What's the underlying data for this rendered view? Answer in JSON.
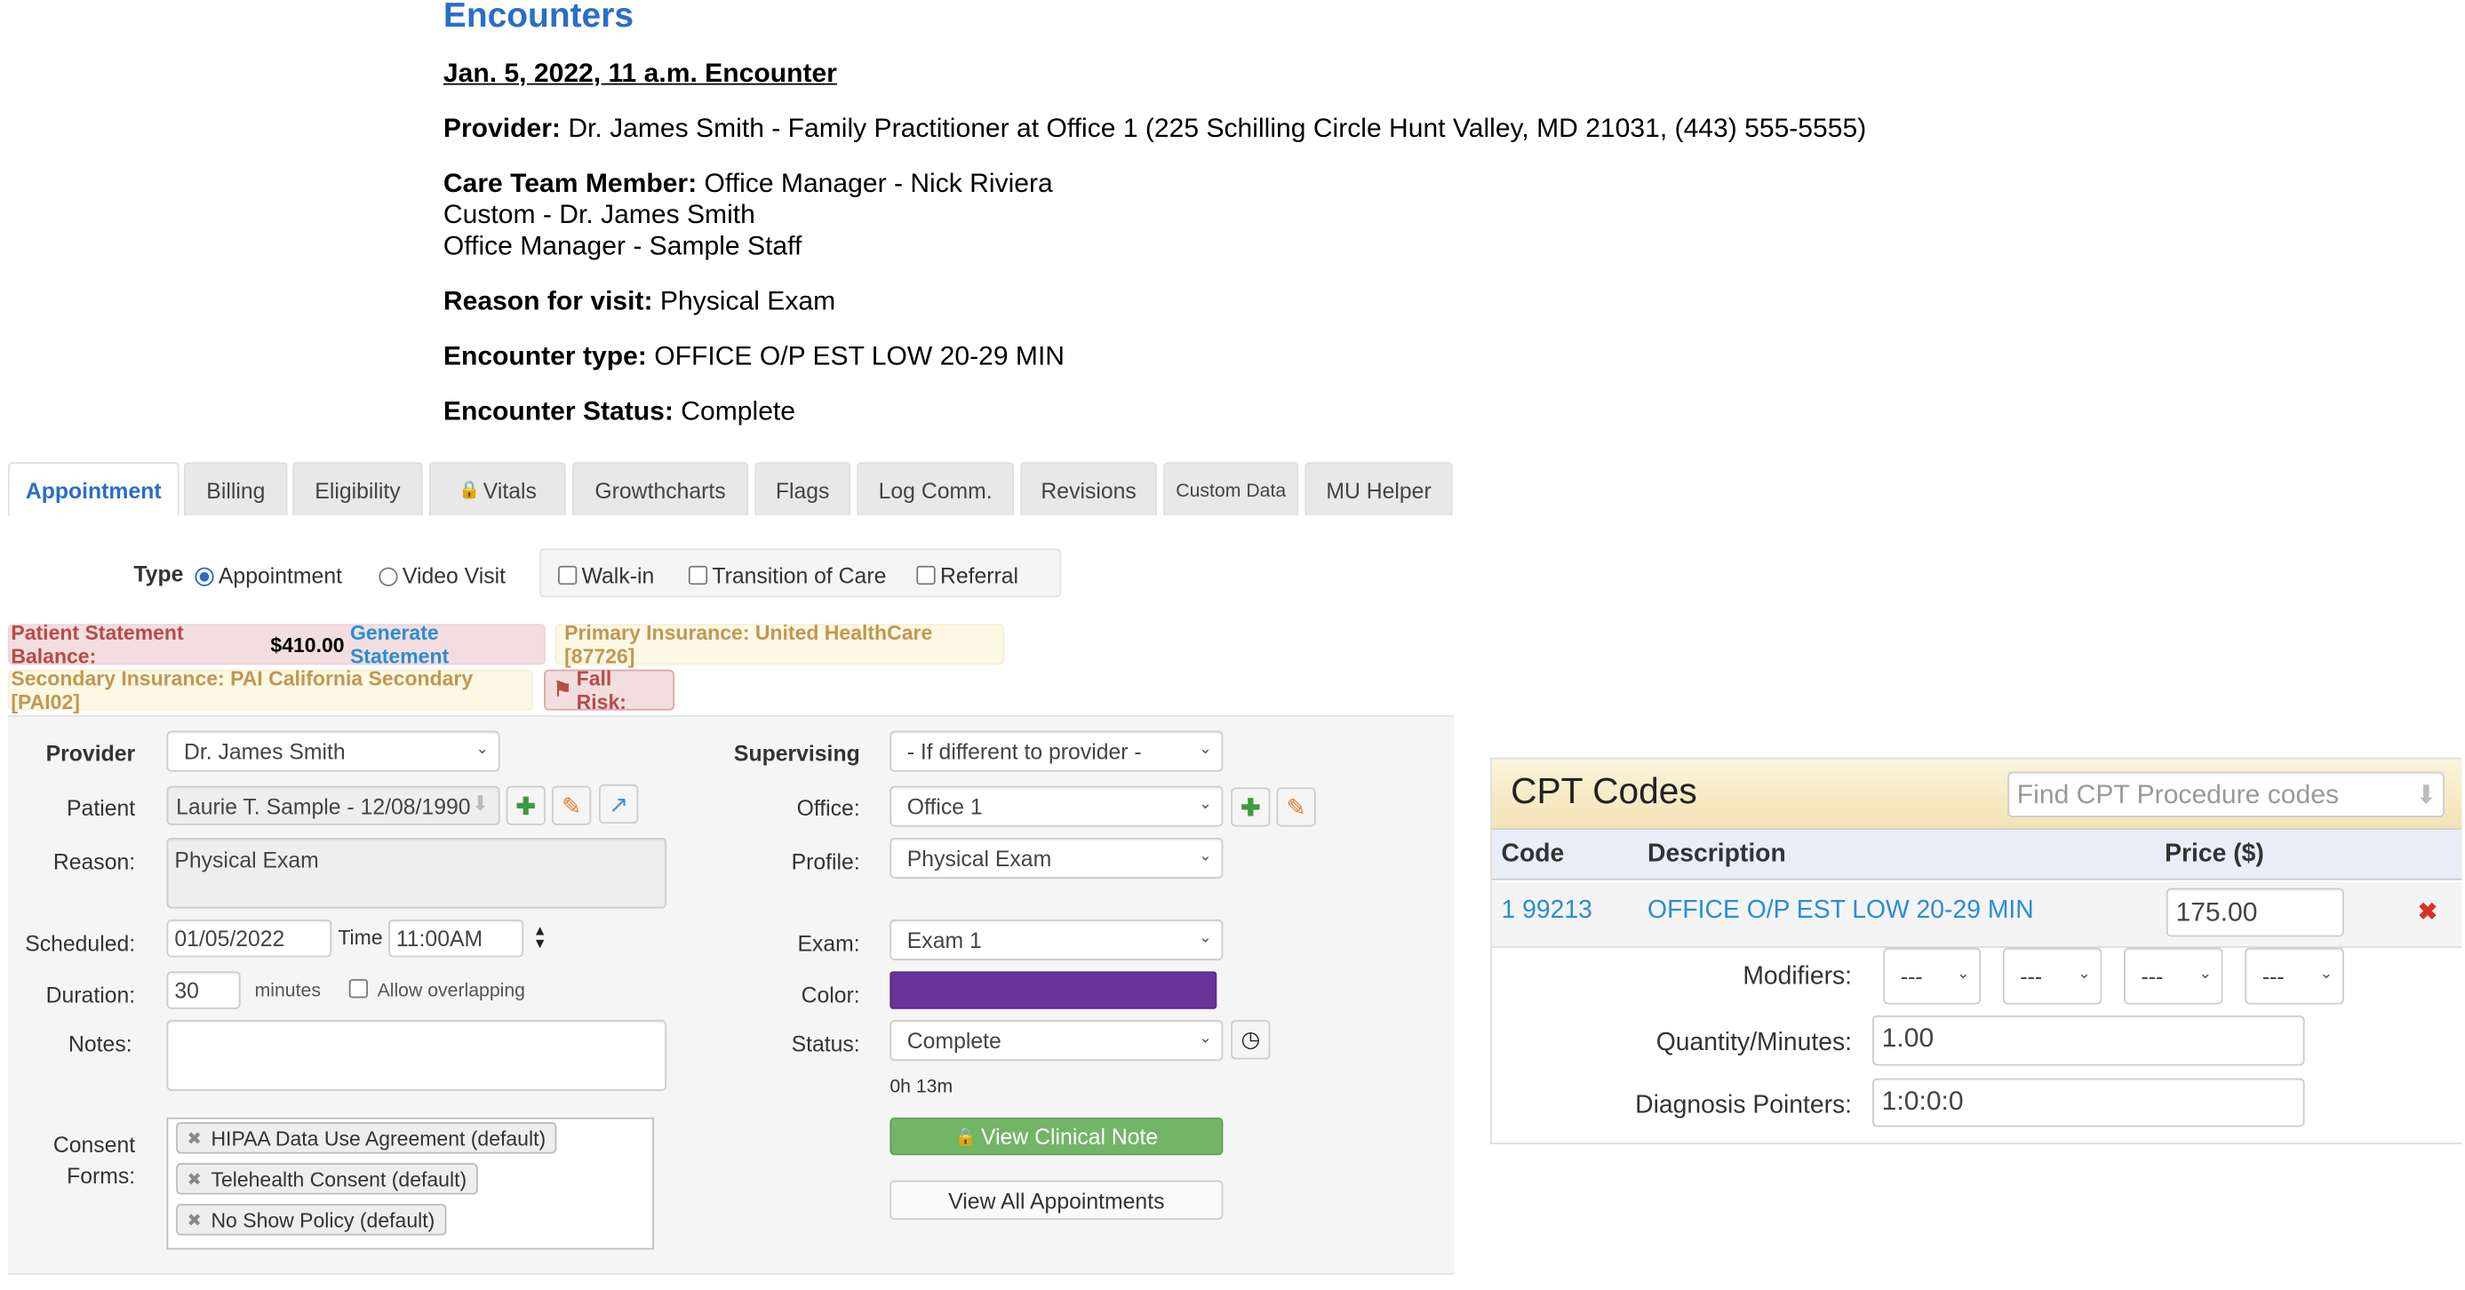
{
  "header": {
    "title": "Encounters",
    "encounter_link": "Jan. 5, 2022, 11 a.m. Encounter",
    "provider_label": "Provider:",
    "provider_value": "Dr. James Smith - Family Practitioner at Office 1 (225 Schilling Circle Hunt Valley, MD 21031, (443) 555-5555)",
    "care_team_label": "Care Team Member:",
    "care_team": [
      "Office Manager - Nick Riviera",
      "Custom - Dr. James Smith",
      "Office Manager - Sample Staff"
    ],
    "reason_label": "Reason for visit:",
    "reason_value": "Physical Exam",
    "type_label": "Encounter type:",
    "type_value": "OFFICE O/P EST LOW 20-29 MIN",
    "status_label": "Encounter Status:",
    "status_value": "Complete"
  },
  "tabs": [
    {
      "label": "Appointment",
      "active": true
    },
    {
      "label": "Billing"
    },
    {
      "label": "Eligibility"
    },
    {
      "label": "Vitals",
      "icon": "lock-icon"
    },
    {
      "label": "Growthcharts"
    },
    {
      "label": "Flags"
    },
    {
      "label": "Log Comm."
    },
    {
      "label": "Revisions"
    },
    {
      "label": "Custom Data"
    },
    {
      "label": "MU Helper"
    }
  ],
  "type_row": {
    "label": "Type",
    "radios": [
      {
        "label": "Appointment",
        "checked": true
      },
      {
        "label": "Video Visit",
        "checked": false
      }
    ],
    "checkboxes": [
      {
        "label": "Walk-in",
        "checked": false
      },
      {
        "label": "Transition of Care",
        "checked": false
      },
      {
        "label": "Referral",
        "checked": false
      }
    ]
  },
  "alerts": {
    "balance_label": "Patient Statement Balance:",
    "balance_value": "$410.00",
    "generate_statement": "Generate Statement",
    "primary_insurance": "Primary Insurance: United HealthCare [87726]",
    "secondary_insurance": "Secondary Insurance: PAI California Secondary [PAI02]",
    "fall_risk": "Fall Risk:"
  },
  "form": {
    "provider_label": "Provider",
    "provider_value": "Dr. James Smith",
    "patient_label": "Patient",
    "patient_value": "Laurie T. Sample - 12/08/1990",
    "reason_label": "Reason:",
    "reason_value": "Physical Exam",
    "scheduled_label": "Scheduled:",
    "scheduled_value": "01/05/2022",
    "time_label": "Time",
    "time_value": "11:00AM",
    "duration_label": "Duration:",
    "duration_value": "30",
    "minutes_label": "minutes",
    "allow_overlapping": "Allow overlapping",
    "notes_label": "Notes:",
    "notes_value": "",
    "consent_label_1": "Consent",
    "consent_label_2": "Forms:",
    "consent_forms": [
      "HIPAA Data Use Agreement (default)",
      "Telehealth Consent (default)",
      "No Show Policy (default)"
    ],
    "supervising_label": "Supervising",
    "supervising_value": "- If different to provider -",
    "office_label": "Office:",
    "office_value": "Office 1",
    "profile_label": "Profile:",
    "profile_value": "Physical Exam",
    "exam_label": "Exam:",
    "exam_value": "Exam 1",
    "color_label": "Color:",
    "color_value": "#6a3399",
    "status_label": "Status:",
    "status_value": "Complete",
    "elapsed": "0h 13m",
    "view_clinical_note": "View Clinical Note",
    "view_all_appointments": "View All Appointments"
  },
  "cpt": {
    "title": "CPT Codes",
    "search_placeholder": "Find CPT Procedure codes",
    "columns": [
      "Code",
      "Description",
      "Price ($)"
    ],
    "rows": [
      {
        "index": "1",
        "code": "99213",
        "description": "OFFICE O/P EST LOW 20-29 MIN",
        "price": "175.00"
      }
    ],
    "modifiers_label": "Modifiers:",
    "modifiers": [
      "---",
      "---",
      "---",
      "---"
    ],
    "quantity_label": "Quantity/Minutes:",
    "quantity_value": "1.00",
    "diagnosis_label": "Diagnosis Pointers:",
    "diagnosis_value": "1:0:0:0"
  },
  "colors": {
    "accent": "#2a6dc9",
    "green": "#72b566",
    "danger": "#b94a48",
    "warning": "#c09853"
  }
}
